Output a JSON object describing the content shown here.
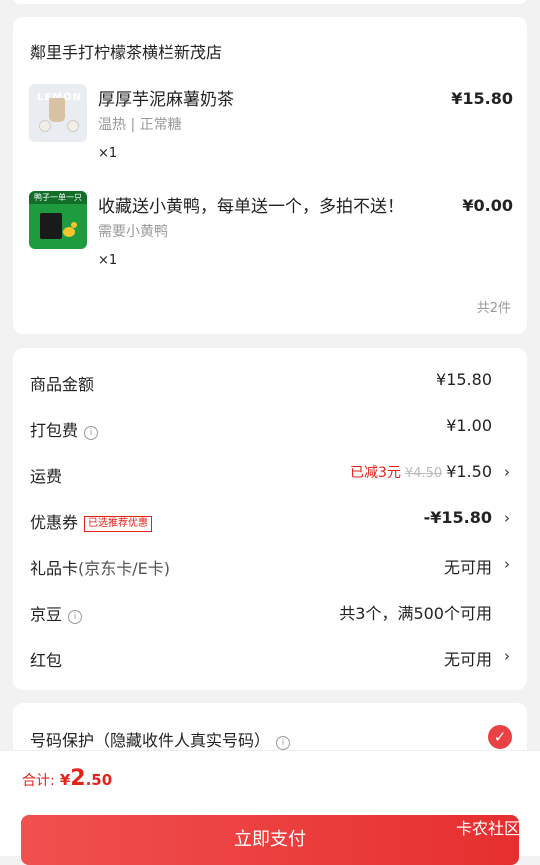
{
  "store": {
    "name": "鄰里手打柠檬茶横栏新茂店",
    "total_count": "共2件",
    "items": [
      {
        "name": "厚厚芋泥麻薯奶茶",
        "spec": "温热 | 正常糖",
        "qty": "×1",
        "price": "¥15.80",
        "thumb_text": "LEMON",
        "thumb_icon": "milk-tea-thumbnail"
      },
      {
        "name": "收藏送小黄鸭，每单送一个，多拍不送！",
        "spec": "需要小黄鸭",
        "qty": "×1",
        "price": "¥0.00",
        "thumb_text": "鸭子一单一只",
        "thumb_icon": "yellow-duck-thumbnail"
      }
    ]
  },
  "fees": {
    "goods_amount": {
      "label": "商品金额",
      "value": "¥15.80"
    },
    "packing": {
      "label": "打包费",
      "value": "¥1.00",
      "icon": "info-icon"
    },
    "shipping": {
      "label": "运费",
      "reduced": "已减3元",
      "original": "¥4.50",
      "value": "¥1.50"
    },
    "coupon": {
      "label": "优惠券",
      "tag": "已选推荐优惠",
      "value": "-¥15.80"
    },
    "gift_card": {
      "label": "礼品卡",
      "sub": "(京东卡/E卡)",
      "value": "无可用"
    },
    "jd_bean": {
      "label": "京豆",
      "value": "共3个，满500个可用",
      "icon": "info-icon"
    },
    "red_packet": {
      "label": "红包",
      "value": "无可用"
    }
  },
  "protection": {
    "label": "号码保护（隐藏收件人真实号码）",
    "checked": true
  },
  "footer": {
    "total_label": "合计:",
    "currency": "¥",
    "total_int": "2",
    "total_dec": ".50",
    "pay_label": "立即支付",
    "watermark": "卡农社区"
  },
  "colors": {
    "accent": "#e2231a",
    "button": "#e94145",
    "background": "#f2f2f2"
  }
}
